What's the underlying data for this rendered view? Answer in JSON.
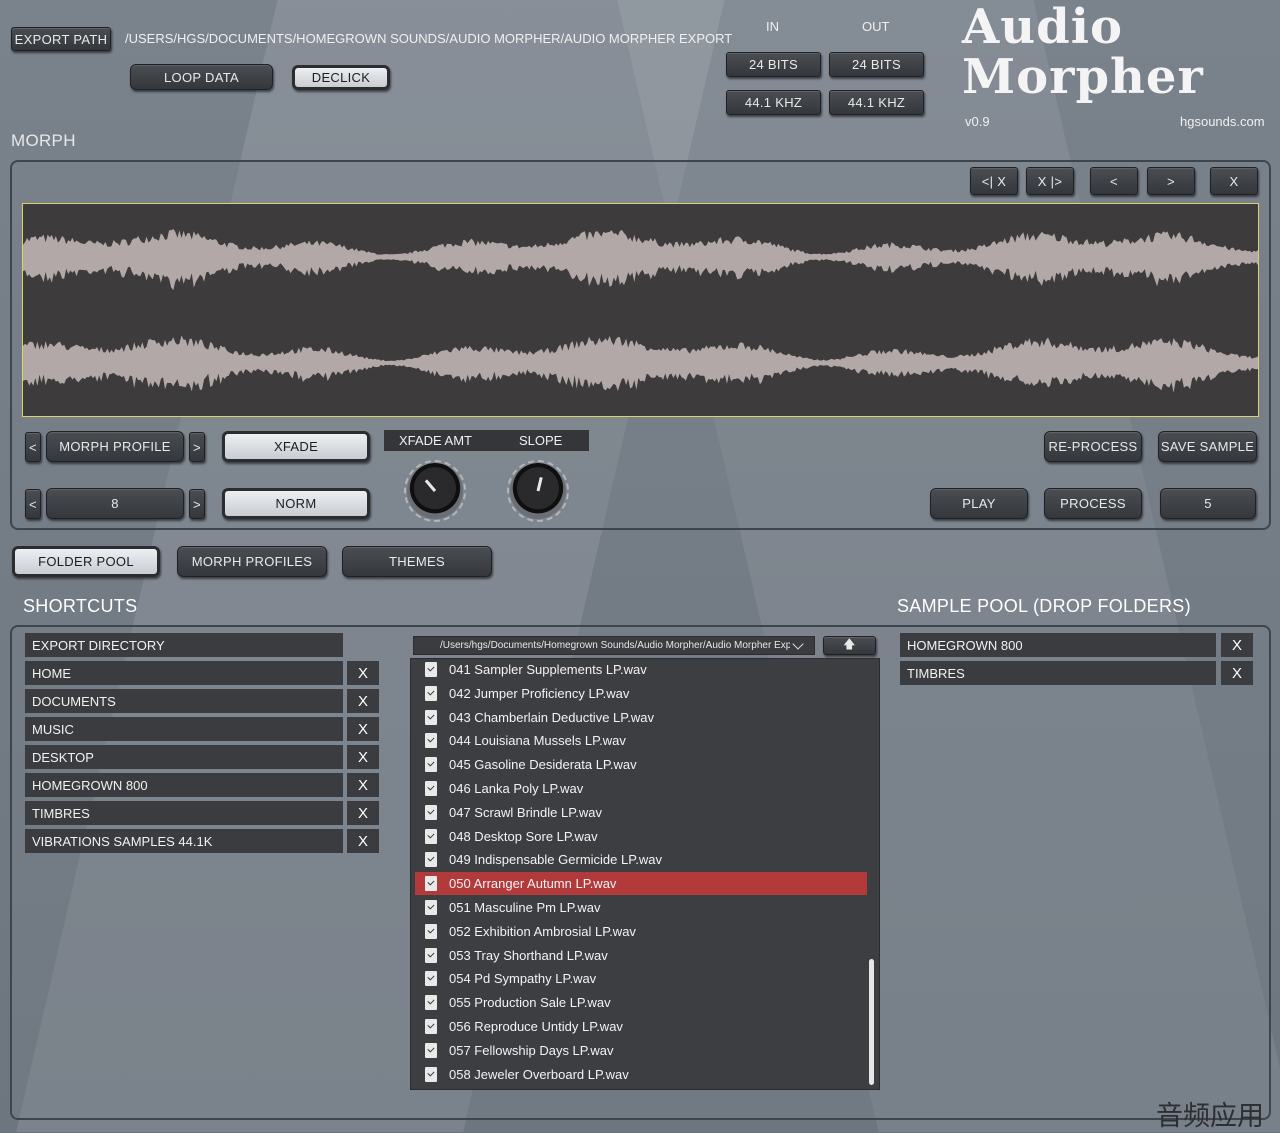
{
  "header": {
    "export_path_button": "EXPORT PATH",
    "export_path_value": "/USERS/HGS/DOCUMENTS/HOMEGROWN SOUNDS/AUDIO MORPHER/AUDIO MORPHER EXPORT",
    "loop_data": "LOOP DATA",
    "declick": "DECLICK",
    "in_label": "IN",
    "out_label": "OUT",
    "in_bits": "24 BITS",
    "out_bits": "24 BITS",
    "in_rate": "44.1 KHZ",
    "out_rate": "44.1 KHZ",
    "logo_line1": "Audio",
    "logo_line2": "Morpher",
    "version": "v0.9",
    "site": "hgsounds.com"
  },
  "morph": {
    "title": "MORPH",
    "nav": [
      "<| X",
      "X |>",
      "<",
      ">",
      "X"
    ],
    "profile_prev": "<",
    "profile_label": "MORPH PROFILE",
    "profile_next": ">",
    "xfade": "XFADE",
    "xfade_amt": "XFADE AMT",
    "slope": "SLOPE",
    "count_prev": "<",
    "count_value": "8",
    "count_next": ">",
    "norm": "NORM",
    "reprocess": "RE-PROCESS",
    "save_sample": "SAVE SAMPLE",
    "play": "PLAY",
    "process": "PROCESS",
    "process_count": "5",
    "xfade_amt_level": 0.35,
    "slope_level": 0.55
  },
  "tabs": [
    "FOLDER POOL",
    "MORPH PROFILES",
    "THEMES"
  ],
  "shortcuts": {
    "title": "SHORTCUTS",
    "export_directory": "EXPORT DIRECTORY",
    "items": [
      "HOME",
      "DOCUMENTS",
      "MUSIC",
      "DESKTOP",
      "HOMEGROWN 800",
      "TIMBRES",
      "VIBRATIONS SAMPLES 44.1K"
    ],
    "remove_label": "X"
  },
  "browser": {
    "path": "/Users/hgs/Documents/Homegrown Sounds/Audio Morpher/Audio Morpher Export",
    "up": "🡅",
    "files": [
      "041 Sampler Supplements LP.wav",
      "042 Jumper Proficiency LP.wav",
      "043 Chamberlain Deductive LP.wav",
      "044 Louisiana Mussels LP.wav",
      "045 Gasoline Desiderata LP.wav",
      "046 Lanka Poly LP.wav",
      "047 Scrawl Brindle LP.wav",
      "048 Desktop Sore LP.wav",
      "049 Indispensable Germicide LP.wav",
      "050 Arranger Autumn LP.wav",
      "051 Masculine Pm LP.wav",
      "052 Exhibition Ambrosial LP.wav",
      "053 Tray Shorthand LP.wav",
      "054 Pd Sympathy LP.wav",
      "055 Production Sale LP.wav",
      "056 Reproduce Untidy LP.wav",
      "057 Fellowship Days LP.wav",
      "058 Jeweler Overboard LP.wav"
    ],
    "selected": "050 Arranger Autumn LP.wav"
  },
  "sample_pool": {
    "title": "SAMPLE POOL (DROP FOLDERS)",
    "items": [
      "HOMEGROWN 800",
      "TIMBRES"
    ],
    "remove_label": "X"
  },
  "watermark": "音频应用",
  "colors": {
    "waveform_bg": "#3d3b3b",
    "waveform": "#b3a8a8",
    "selection": "#b23a3a",
    "waveform_border": "#d9d36a"
  }
}
